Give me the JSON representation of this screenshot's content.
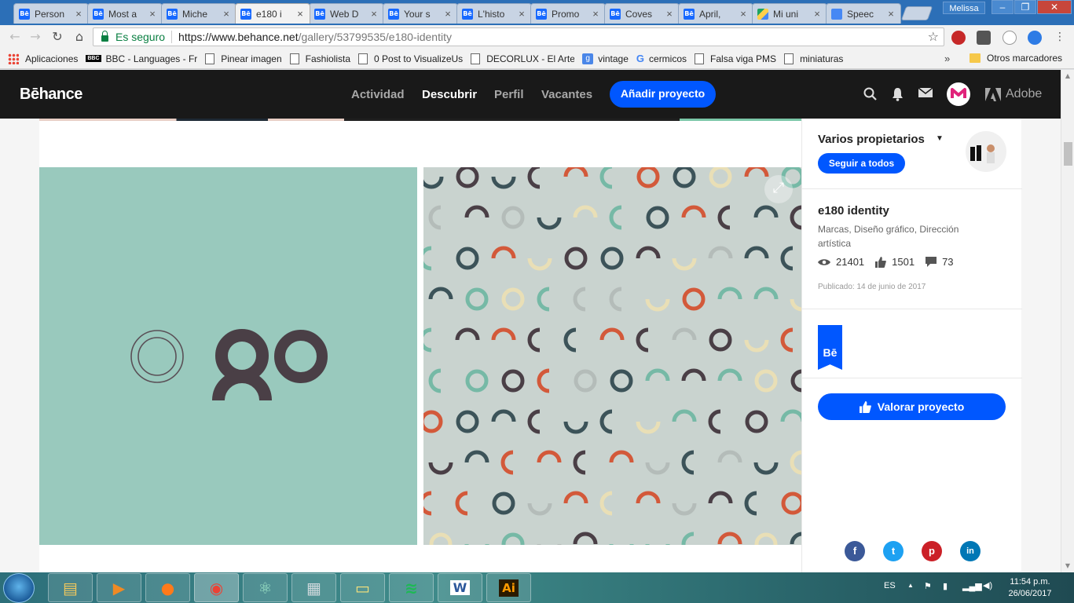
{
  "browser": {
    "tabs": [
      {
        "label": "Person",
        "icon": "behance"
      },
      {
        "label": "Most a",
        "icon": "behance"
      },
      {
        "label": "Miche",
        "icon": "behance"
      },
      {
        "label": "e180 i",
        "icon": "behance",
        "active": true
      },
      {
        "label": "Web D",
        "icon": "behance"
      },
      {
        "label": "Your s",
        "icon": "behance"
      },
      {
        "label": "L'histo",
        "icon": "behance"
      },
      {
        "label": "Promo",
        "icon": "behance"
      },
      {
        "label": "Coves",
        "icon": "behance"
      },
      {
        "label": "April,",
        "icon": "behance"
      },
      {
        "label": "Mi uni",
        "icon": "drive"
      },
      {
        "label": "Speec",
        "icon": "docs"
      }
    ],
    "profile_name": "Melissa",
    "secure_label": "Es seguro",
    "url_host": "https://www.behance.net",
    "url_path": "/gallery/53799535/e180-identity",
    "bookmarks": [
      {
        "label": "Aplicaciones",
        "icon": "apps"
      },
      {
        "label": "BBC - Languages - Fr",
        "icon": "bbc"
      },
      {
        "label": "Pinear imagen",
        "icon": "page"
      },
      {
        "label": "Fashiolista",
        "icon": "page"
      },
      {
        "label": "0 Post to VisualizeUs",
        "icon": "page"
      },
      {
        "label": "DECORLUX - El Arte c",
        "icon": "page"
      },
      {
        "label": "vintage",
        "icon": "google-blue"
      },
      {
        "label": "cermicos",
        "icon": "google"
      },
      {
        "label": "Falsa viga PMS",
        "icon": "page"
      },
      {
        "label": "miniaturas",
        "icon": "page"
      }
    ],
    "bookmarks_more": "»",
    "other_bookmarks": "Otros marcadores"
  },
  "behance": {
    "logo": "Bēhance",
    "nav": [
      {
        "label": "Actividad",
        "current": false
      },
      {
        "label": "Descubrir",
        "current": true
      },
      {
        "label": "Perfil",
        "current": false
      },
      {
        "label": "Vacantes",
        "current": false
      }
    ],
    "add_project": "Añadir proyecto",
    "adobe": "Adobe",
    "brand_color": "#0057ff"
  },
  "project": {
    "owners": "Varios propietarios",
    "follow_all": "Seguir a todos",
    "title": "e180 identity",
    "fields": "Marcas, Diseño gráfico, Dirección artística",
    "views": "21401",
    "appreciations": "1501",
    "comments": "73",
    "published": "Publicado: 14 de junio de 2017",
    "badge": "Bē",
    "appreciate_label": "Valorar proyecto",
    "share": [
      {
        "name": "facebook",
        "glyph": "f",
        "color": "#3b5998"
      },
      {
        "name": "twitter",
        "glyph": "t",
        "color": "#1da1f2"
      },
      {
        "name": "pinterest",
        "glyph": "p",
        "color": "#cb2027"
      },
      {
        "name": "linkedin",
        "glyph": "in",
        "color": "#0077b5"
      }
    ],
    "panel_colors": {
      "left_bg": "#99c9bd",
      "right_bg": "#c9d3cf",
      "dark": "#4a3f46",
      "teal": "#76b9a6",
      "slate": "#3c5359",
      "orange": "#d3593a",
      "cream": "#e9dfb6",
      "grey": "#b4bcb9"
    }
  },
  "taskbar": {
    "apps": [
      "explorer",
      "media-player",
      "firefox",
      "chrome",
      "atom",
      "calculator",
      "sticky-notes",
      "spotify",
      "word",
      "illustrator"
    ],
    "active_app": "chrome",
    "language": "ES",
    "time": "11:54 p.m.",
    "date": "26/06/2017"
  }
}
